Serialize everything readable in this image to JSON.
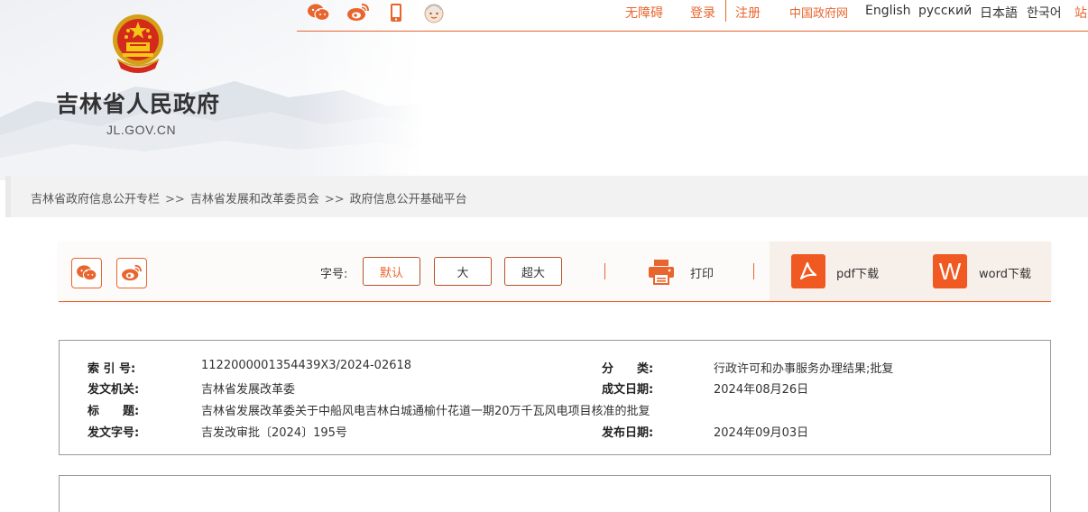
{
  "site": {
    "name": "吉林省人民政府",
    "domain": "JL.GOV.CN"
  },
  "topbar": {
    "accessibility": "无障碍",
    "login": "登录",
    "register": "注册",
    "cn_gov": "中国政府网",
    "lang_en": "English",
    "lang_ru": "русский",
    "lang_ja": "日本語",
    "lang_ko": "한국어",
    "site_nav_partial": "站"
  },
  "breadcrumb": {
    "items": [
      "吉林省政府信息公开专栏",
      "吉林省发展和改革委员会",
      "政府信息公开基础平台"
    ],
    "separator": ">>"
  },
  "toolbar": {
    "font_size_label": "字号:",
    "font_sizes": [
      "默认",
      "大",
      "超大"
    ],
    "print_label": "打印",
    "pdf_label": "pdf下载",
    "word_label": "word下载"
  },
  "meta": {
    "index_label": "索 引 号:",
    "index_value": "1122000001354439X3/2024-02618",
    "category_label": "分　　类:",
    "category_value": "行政许可和办事服务办理结果;批复",
    "issuer_label": "发文机关:",
    "issuer_value": "吉林省发展改革委",
    "written_date_label": "成文日期:",
    "written_date_value": "2024年08月26日",
    "title_label": "标　　题:",
    "title_value": "吉林省发展改革委关于中船风电吉林白城通榆什花道一期20万千瓦风电项目核准的批复",
    "doc_no_label": "发文字号:",
    "doc_no_value": "吉发改审批〔2024〕195号",
    "publish_date_label": "发布日期:",
    "publish_date_value": "2024年09月03日"
  },
  "colors": {
    "accent": "#e8652e",
    "pdf": "#f05a22",
    "word": "#f05a22"
  }
}
